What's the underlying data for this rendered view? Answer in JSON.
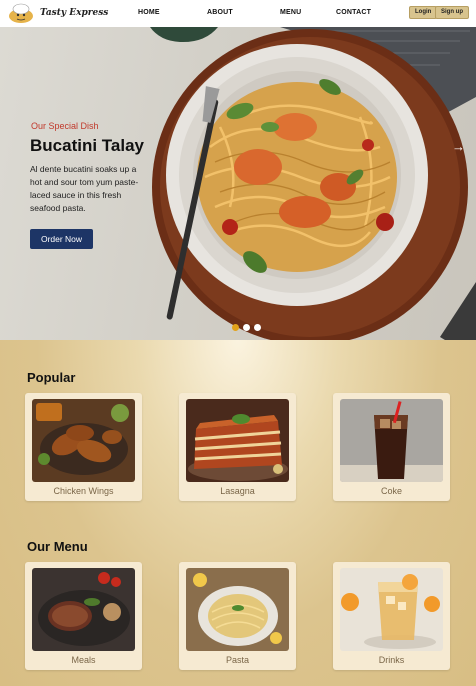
{
  "brand": {
    "name": "Tasty Express"
  },
  "nav": {
    "links": [
      "HOME",
      "ABOUT",
      "MENU",
      "CONTACT"
    ],
    "login": "Login",
    "signup": "Sign up"
  },
  "hero": {
    "kicker": "Our Special Dish",
    "title": "Bucatini Talay",
    "description": "Al dente bucatini soaks up a hot and sour tom yum paste-laced sauce in this fresh seafood pasta.",
    "cta": "Order Now",
    "slides_total": 3,
    "active_slide": 1
  },
  "popular": {
    "title": "Popular",
    "items": [
      "Chicken Wings",
      "Lasagna",
      "Coke"
    ]
  },
  "menu": {
    "title": "Our Menu",
    "items": [
      "Meals",
      "Pasta",
      "Drinks"
    ]
  },
  "colors": {
    "accent_red": "#c0392b",
    "button_navy": "#1d3566",
    "slider_active": "#e3a21a",
    "section_gold": "#dcc48e"
  }
}
